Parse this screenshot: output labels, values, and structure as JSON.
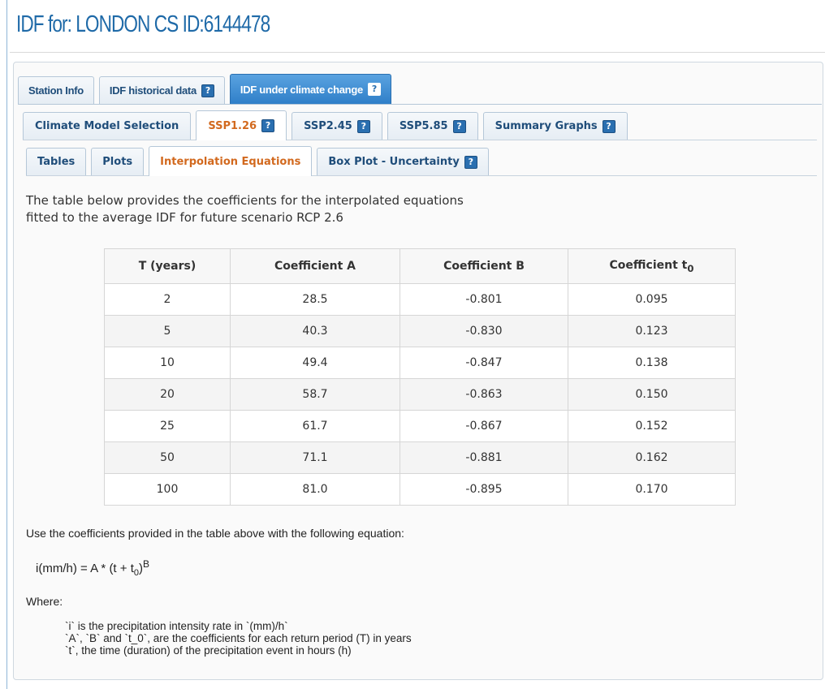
{
  "page": {
    "title": "IDF for: LONDON CS ID:6144478"
  },
  "tabs_level1": [
    {
      "label": "Station Info",
      "help": false,
      "active": false
    },
    {
      "label": "IDF historical data",
      "help": true,
      "active": false
    },
    {
      "label": "IDF under climate change",
      "help": true,
      "active": true
    }
  ],
  "tabs_level2": [
    {
      "label": "Climate Model Selection",
      "help": false,
      "active": false
    },
    {
      "label": "SSP1.26",
      "help": true,
      "active": true
    },
    {
      "label": "SSP2.45",
      "help": true,
      "active": false
    },
    {
      "label": "SSP5.85",
      "help": true,
      "active": false
    },
    {
      "label": "Summary Graphs",
      "help": true,
      "active": false
    }
  ],
  "tabs_level3": [
    {
      "label": "Tables",
      "help": false,
      "active": false
    },
    {
      "label": "Plots",
      "help": false,
      "active": false
    },
    {
      "label": "Interpolation Equations",
      "help": false,
      "active": true
    },
    {
      "label": "Box Plot - Uncertainty",
      "help": true,
      "active": false
    }
  ],
  "help_glyph": "?",
  "intro": {
    "line1": "The table below provides the coefficients for the interpolated equations",
    "line2": "fitted to the average IDF for future scenario RCP 2.6"
  },
  "table": {
    "headers": {
      "t_years": "T (years)",
      "coef_a": "Coefficient A",
      "coef_b": "Coefficient B",
      "coef_t0_main": "Coefficient t",
      "coef_t0_sub": "0"
    },
    "rows": [
      [
        "2",
        "28.5",
        "-0.801",
        "0.095"
      ],
      [
        "5",
        "40.3",
        "-0.830",
        "0.123"
      ],
      [
        "10",
        "49.4",
        "-0.847",
        "0.138"
      ],
      [
        "20",
        "58.7",
        "-0.863",
        "0.150"
      ],
      [
        "25",
        "61.7",
        "-0.867",
        "0.152"
      ],
      [
        "50",
        "71.1",
        "-0.881",
        "0.162"
      ],
      [
        "100",
        "81.0",
        "-0.895",
        "0.170"
      ]
    ]
  },
  "usage_text": "Use the coefficients provided in the table above with the following equation:",
  "equation": {
    "prefix": "i(mm/h) = A * (t + t",
    "sub": "0",
    "close": ")",
    "sup": "B"
  },
  "where_label": "Where:",
  "definitions": [
    "`i` is the precipitation intensity rate in `(mm)/h`",
    "`A`, `B` and `t_0`, are the coefficients for each return period (T) in years",
    "`t`, the time (duration) of the precipitation event in hours (h)"
  ],
  "colors": {
    "title": "#1f6aa8",
    "active_tab_bg": "#2f7fc8",
    "active_subtab_text": "#d2691e",
    "help_icon": "#2a6fb0"
  }
}
